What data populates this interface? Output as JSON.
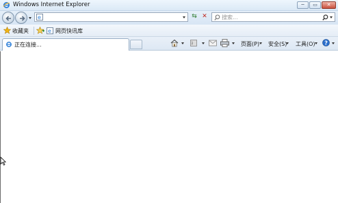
{
  "window": {
    "title": "Windows Internet Explorer"
  },
  "controls": {
    "minimize": "─",
    "maximize": "▭",
    "close": "✕"
  },
  "search": {
    "placeholder": "搜索..."
  },
  "favorites_bar": {
    "favorites_label": "收藏夹",
    "items": [
      {
        "label": "网页快讯库"
      }
    ]
  },
  "tabs": [
    {
      "label": "正在连接..."
    }
  ],
  "command_bar": {
    "page": "页面(P)",
    "safety": "安全(S)",
    "tools": "工具(O)"
  },
  "colors": {
    "chrome": "#dbe9f6",
    "accent": "#1f5fb3",
    "close": "#c9503d",
    "star": "#f3b614"
  }
}
